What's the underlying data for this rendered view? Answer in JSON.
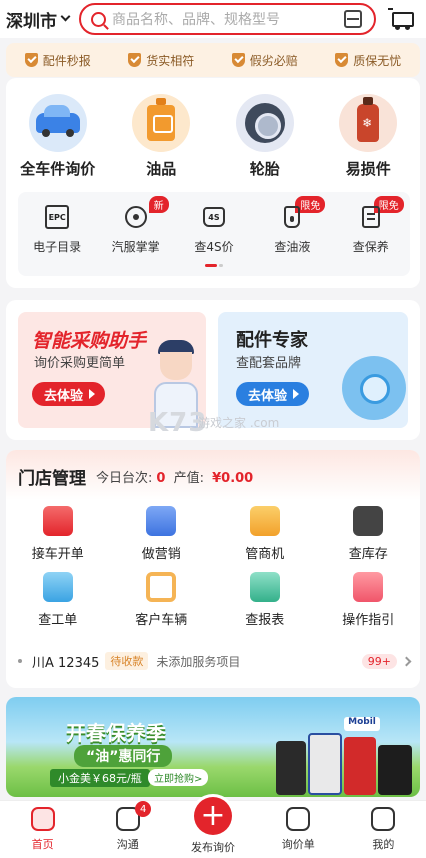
{
  "header": {
    "city": "深圳市",
    "search_placeholder": "商品名称、品牌、规格型号"
  },
  "guarantees": [
    "配件秒报",
    "货实相符",
    "假劣必赔",
    "质保无忧"
  ],
  "categories": [
    {
      "label": "全车件询价",
      "icon": "car-icon"
    },
    {
      "label": "油品",
      "icon": "oil-can-icon"
    },
    {
      "label": "轮胎",
      "icon": "tire-icon"
    },
    {
      "label": "易损件",
      "icon": "coolant-bottle-icon"
    }
  ],
  "tools": [
    {
      "label": "电子目录",
      "icon_text": "EPC",
      "badge": ""
    },
    {
      "label": "汽服掌掌",
      "icon_text": "",
      "badge": "新"
    },
    {
      "label": "查4S价",
      "icon_text": "4S",
      "badge": ""
    },
    {
      "label": "查油液",
      "icon_text": "",
      "badge": "限免"
    },
    {
      "label": "查保养",
      "icon_text": "",
      "badge": "限免"
    }
  ],
  "promo": {
    "left": {
      "title": "智能采购助手",
      "subtitle": "询价采购更简单",
      "button": "去体验"
    },
    "right": {
      "title": "配件专家",
      "subtitle": "查配套品牌",
      "button": "去体验"
    }
  },
  "watermark": {
    "main": "K73",
    "sub": "游戏之家 .com"
  },
  "store": {
    "title": "门店管理",
    "today_label": "今日台次:",
    "today_count": "0",
    "revenue_label": "产值:",
    "revenue_value": "¥0.00",
    "items": [
      {
        "label": "接车开单"
      },
      {
        "label": "做营销"
      },
      {
        "label": "管商机"
      },
      {
        "label": "查库存"
      },
      {
        "label": "查工单"
      },
      {
        "label": "客户车辆"
      },
      {
        "label": "查报表"
      },
      {
        "label": "操作指引"
      }
    ],
    "order": {
      "plate": "川A 12345",
      "status": "待收款",
      "service": "未添加服务项目",
      "count": "99+"
    }
  },
  "banner": {
    "title": "开春保养季",
    "subtitle": "“油”惠同行",
    "price": "小金美￥68元/瓶",
    "buy": "立即抢购>",
    "brand": "Mobil"
  },
  "tabbar": [
    {
      "label": "首页",
      "badge": ""
    },
    {
      "label": "沟通",
      "badge": "4"
    },
    {
      "label": "发布询价",
      "badge": ""
    },
    {
      "label": "询价单",
      "badge": ""
    },
    {
      "label": "我的",
      "badge": ""
    }
  ],
  "colors": {
    "accent": "#e3242b",
    "guarantee_bg": "#fdf1e3",
    "blue_button": "#2a7fe0"
  }
}
